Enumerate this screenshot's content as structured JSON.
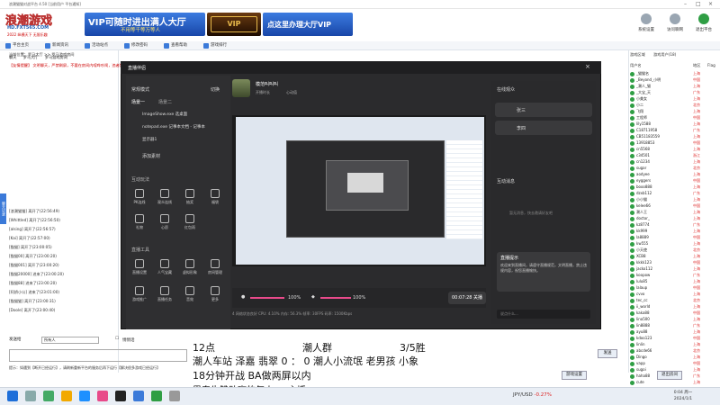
{
  "window": {
    "title": "浪潮猫猫对战平台 4.50 [当前用户 平台通知]"
  },
  "banner": {
    "logo_main": "浪潮游戏",
    "logo_url": "HD.FXT565.COM",
    "logo_sub": "2022 纵横天下 无限乐趣",
    "ad1_main": "VIP可随时进出满人大厅",
    "ad1_sub": "不用等千等万等人",
    "ad2_text": "VIP",
    "ad3_text": "点这里办理大厅VIP"
  },
  "top_buttons": [
    {
      "label": "系统设置",
      "icon": "gear-icon"
    },
    {
      "label": "访问聊网",
      "icon": "web-icon"
    },
    {
      "label": "退出平台",
      "icon": "exit-icon"
    }
  ],
  "toolbar": {
    "items": [
      "平台主页",
      "新闻资讯",
      "活动站点",
      "修改密码",
      "查看帮助",
      "游戏排行"
    ]
  },
  "left": {
    "location": "当前位置：罗马大厅 >> 罗马游戏房间",
    "tabs": [
      "聊天",
      "罗马大厅",
      "罗马游戏房间"
    ],
    "notice": "【友情提醒】 文明聊天，严禁刷屏，不要在房间内喧哗吵闹，违者禁言处理",
    "side_tab": "聊天记录",
    "chat_lines": [
      "[浪潮猫猫] 离开了(22:56:49)",
      "[Whittled] 离开了(22:56:50)",
      "[alsing] 离开了(22:56:57)",
      "[Kai] 离开了(22:57:00)",
      "[猫猫] 离开了(23:00:05)",
      "[猫猫00] 离开了(23:00:20)",
      "[猫猫001] 离开了(23:00:20)",
      "[猫猫20000] 进来了(23:00:20)",
      "[猫猫88] 进来了(23:00:20)",
      "[阿娇小公] 进来了(23:01:00)",
      "[猫猫猫] 离开了(23:00:31)",
      "[Doole] 离开了(23:00:40)"
    ],
    "input_label": "发送给",
    "input_value": "所有人",
    "checkbox_label": "悄悄话"
  },
  "studio": {
    "app_name": "直播伴侣",
    "scene_label": "常规模式",
    "scene_switch": "切换",
    "scene_tabs": [
      "场景一",
      "场景二"
    ],
    "sources": [
      "ImageShow.exe 选桌面",
      "notepad.exe 记事本文档 - 记事本",
      "显示器1"
    ],
    "add_material": "添加素材",
    "interact_title": "互动玩法",
    "interact_tools": [
      "PK连线",
      "观众连线",
      "抽奖",
      "福袋"
    ],
    "interact_tools2": [
      "礼物",
      "心愿",
      "红包雨"
    ],
    "live_tools_title": "直播工具",
    "live_tools": [
      "直播设置",
      "人气宝藏",
      "虚拟形象",
      "房间管理"
    ],
    "live_tools2": [
      "游戏推广",
      "直播任务",
      "音效",
      "更多"
    ],
    "streamer_name": "模范叫叫叫",
    "streamer_tags": [
      "开播时长",
      "心动值"
    ],
    "status": "4 网络状态良好    CPU: 4.10%    内存: 56.3%    帧率: 30FPS    码率: 1500Kbps",
    "vol1": "100%",
    "vol2": "100%",
    "timer": "00:07:28",
    "live_btn": "00:07:28 关播",
    "right_title": "在线观众",
    "viewers": [
      "张三",
      "李四"
    ],
    "msg_title": "互动消息",
    "msg_empty": "暂无消息，快去邀请好友吧",
    "notice_title": "直播提示",
    "notice_text": "欢迎来到直播间，请遵守直播规范，文明直播，禁止违规内容，祝您直播愉快。",
    "chat_input": "说点什么..."
  },
  "overlay": {
    "line1_a": "12点",
    "line1_b": "潮人群",
    "line1_c": "3/5胜",
    "line2": "潮人车站  泽嘉  翡翠    0 ：  0  潮人小流氓  老男孩  小象",
    "line3": "18分钟开战  BA做两屏以内",
    "line4": "思春牛赞助赢的每人66  主播60"
  },
  "userlist": {
    "tabs": [
      "游戏区域",
      "游戏用户(18)"
    ],
    "headers": [
      "用户名",
      "地区",
      "Flag"
    ],
    "users": [
      {
        "name": "_猫猫名",
        "region": "上海"
      },
      {
        "name": "_Beyond_小明",
        "region": "中国"
      },
      {
        "name": "_潮人_猫",
        "region": "上海"
      },
      {
        "name": "_大宝_天",
        "region": "广东"
      },
      {
        "name": "小美女",
        "region": "上海"
      },
      {
        "name": "小二",
        "region": "北京"
      },
      {
        "name": "飞翔",
        "region": "上海"
      },
      {
        "name": "工程师",
        "region": "中国"
      },
      {
        "name": "lily1588",
        "region": "上海"
      },
      {
        "name": "C18711958",
        "region": "广东"
      },
      {
        "name": "CB51183559",
        "region": "上海"
      },
      {
        "name": "13918853",
        "region": "中国"
      },
      {
        "name": "cn5568",
        "region": "上海"
      },
      {
        "name": "c34501",
        "region": "浙江"
      },
      {
        "name": "cn1234",
        "region": "上海"
      },
      {
        "name": "sugar",
        "region": "北京"
      },
      {
        "name": "aodyee",
        "region": "上海"
      },
      {
        "name": "eyggers",
        "region": "中国"
      },
      {
        "name": "booo888",
        "region": "上海"
      },
      {
        "name": "dzxb112",
        "region": "广东"
      },
      {
        "name": "小小猫",
        "region": "上海"
      },
      {
        "name": "kelee66",
        "region": "中国"
      },
      {
        "name": "潮人王",
        "region": "上海"
      },
      {
        "name": "doctor_",
        "region": "上海"
      },
      {
        "name": "kz8774",
        "region": "广东"
      },
      {
        "name": "kk999",
        "region": "上海"
      },
      {
        "name": "la8889",
        "region": "中国"
      },
      {
        "name": "kw555",
        "region": "上海"
      },
      {
        "name": "小天使",
        "region": "北京"
      },
      {
        "name": "XCB8",
        "region": "上海"
      },
      {
        "name": "kkkk123",
        "region": "中国"
      },
      {
        "name": "jacko112",
        "region": "上海"
      },
      {
        "name": "koopow",
        "region": "广东"
      },
      {
        "name": "lulu85",
        "region": "上海"
      },
      {
        "name": "lalaup",
        "region": "中国"
      },
      {
        "name": "cvvo",
        "region": "上海"
      },
      {
        "name": "tec_cc",
        "region": "北京"
      },
      {
        "name": "ii_world",
        "region": "上海"
      },
      {
        "name": "kaka88",
        "region": "中国"
      },
      {
        "name": "lina500",
        "region": "上海"
      },
      {
        "name": "lin8888",
        "region": "广东"
      },
      {
        "name": "ayu88",
        "region": "上海"
      },
      {
        "name": "kdoo123",
        "region": "中国"
      },
      {
        "name": "linlin",
        "region": "上海"
      },
      {
        "name": "abcde66",
        "region": "北京"
      },
      {
        "name": "Dingo",
        "region": "上海"
      },
      {
        "name": "vapp",
        "region": "中国"
      },
      {
        "name": "sugoi",
        "region": "上海"
      },
      {
        "name": "haha88",
        "region": "广东"
      },
      {
        "name": "cute",
        "region": "上海"
      }
    ]
  },
  "bottom": {
    "tip": "提示：如遇到【断开已经运行】，请刷新重新平台的服务后再下运行【解决很多游戏已经运行】",
    "send_label": "发送",
    "set_label": "游戏设置",
    "exit_label": "退出房间"
  },
  "taskbar": {
    "tray_market": "JPY/USD",
    "tray_change": "-0.27%",
    "clock_time": "0:04 周一",
    "clock_date": "2024/1/1"
  },
  "colors": {
    "accent": "#3b7ad9",
    "studio_bg": "#2b2b2d",
    "live_pink": "#e84a8a",
    "notice_red": "#cc0000"
  }
}
